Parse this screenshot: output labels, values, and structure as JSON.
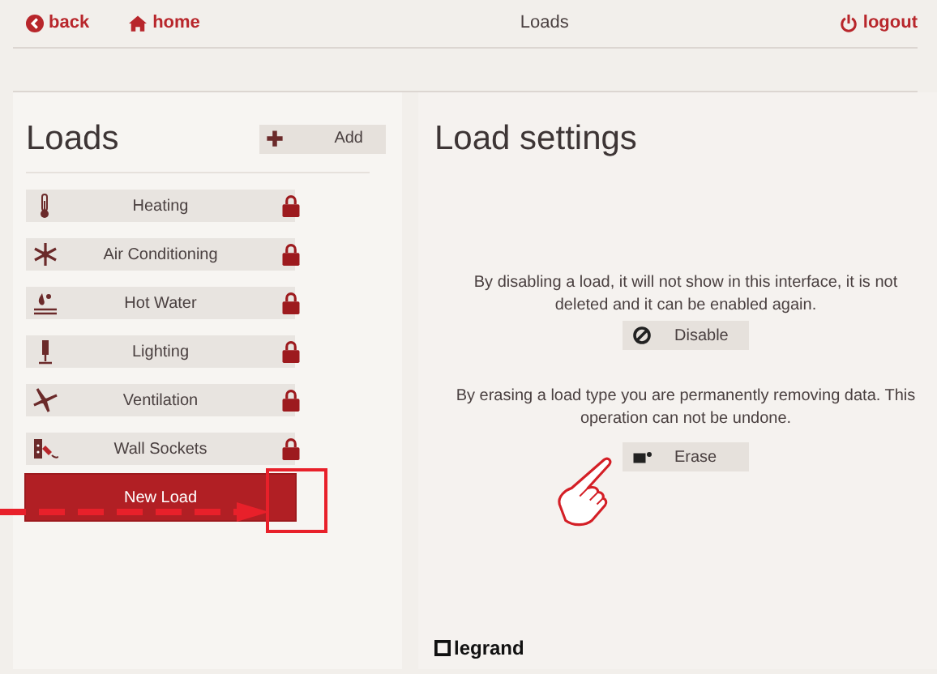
{
  "nav": {
    "back": "back",
    "home": "home",
    "title": "Loads",
    "logout": "logout"
  },
  "loads_panel": {
    "title": "Loads",
    "add_button": "Add",
    "items": [
      {
        "label": "Heating",
        "kind": "heating",
        "locked": true,
        "selected": false
      },
      {
        "label": "Air Conditioning",
        "kind": "cooling",
        "locked": true,
        "selected": false
      },
      {
        "label": "Hot Water",
        "kind": "water",
        "locked": true,
        "selected": false
      },
      {
        "label": "Lighting",
        "kind": "lighting",
        "locked": true,
        "selected": false
      },
      {
        "label": "Ventilation",
        "kind": "ventilation",
        "locked": true,
        "selected": false
      },
      {
        "label": "Wall Sockets",
        "kind": "sockets",
        "locked": true,
        "selected": false
      },
      {
        "label": "New Load",
        "kind": "plain",
        "locked": false,
        "selected": true
      }
    ]
  },
  "settings": {
    "title": "Load settings",
    "disable_text": "By disabling a load, it will not show in this interface, it is not deleted and it can be enabled again.",
    "disable_button": "Disable",
    "erase_text": "By erasing a load type you are permanently removing data. This operation can not be undone.",
    "erase_button": "Erase"
  },
  "brand": "legrand",
  "annotations": {
    "arrow": true,
    "highlight_box": true,
    "pointer_hand": true
  }
}
